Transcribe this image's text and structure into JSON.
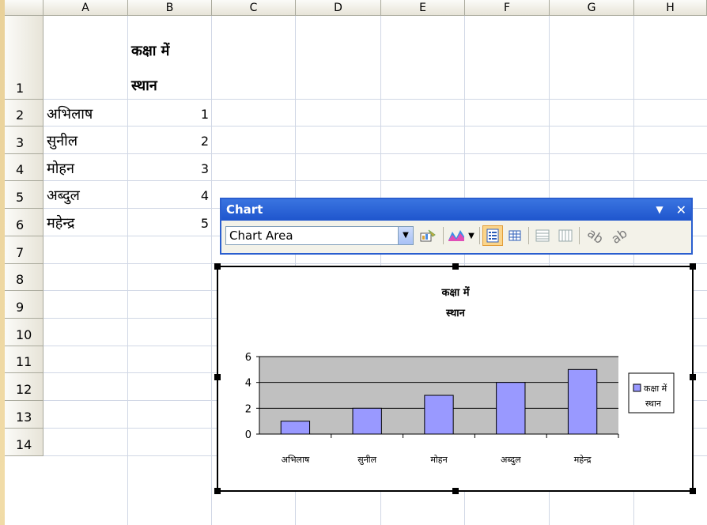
{
  "columns": [
    "A",
    "B",
    "C",
    "D",
    "E",
    "F",
    "G",
    "H"
  ],
  "rows": [
    "1",
    "2",
    "3",
    "4",
    "5",
    "6",
    "7",
    "8",
    "9",
    "10",
    "11",
    "12",
    "13",
    "14"
  ],
  "cells": {
    "b1_line1": "कक्षा में",
    "b1_line2": "स्थान",
    "names": [
      "अभिलाष",
      "सुनील",
      "मोहन",
      "अब्दुल",
      "महेन्द्र"
    ],
    "ranks": [
      "1",
      "2",
      "3",
      "4",
      "5"
    ]
  },
  "toolbar": {
    "title": "Chart",
    "dropdown_value": "Chart Area",
    "menu_glyph": "▼",
    "close_glyph": "✕"
  },
  "chart_data": {
    "type": "bar",
    "title_line1": "कक्षा में",
    "title_line2": "स्थान",
    "categories": [
      "अभिलाष",
      "सुनील",
      "मोहन",
      "अब्दुल",
      "महेन्द्र"
    ],
    "series": [
      {
        "name": "कक्षा में स्थान",
        "values": [
          1,
          2,
          3,
          4,
          5
        ]
      }
    ],
    "ylim": [
      0,
      6
    ],
    "yticks": [
      "0",
      "2",
      "4",
      "6"
    ],
    "legend_line1": "कक्षा में",
    "legend_line2": "स्थान",
    "legend_position": "right",
    "plot_bg": "#c0c0c0",
    "bar_color": "#9999ff",
    "grid": true
  }
}
